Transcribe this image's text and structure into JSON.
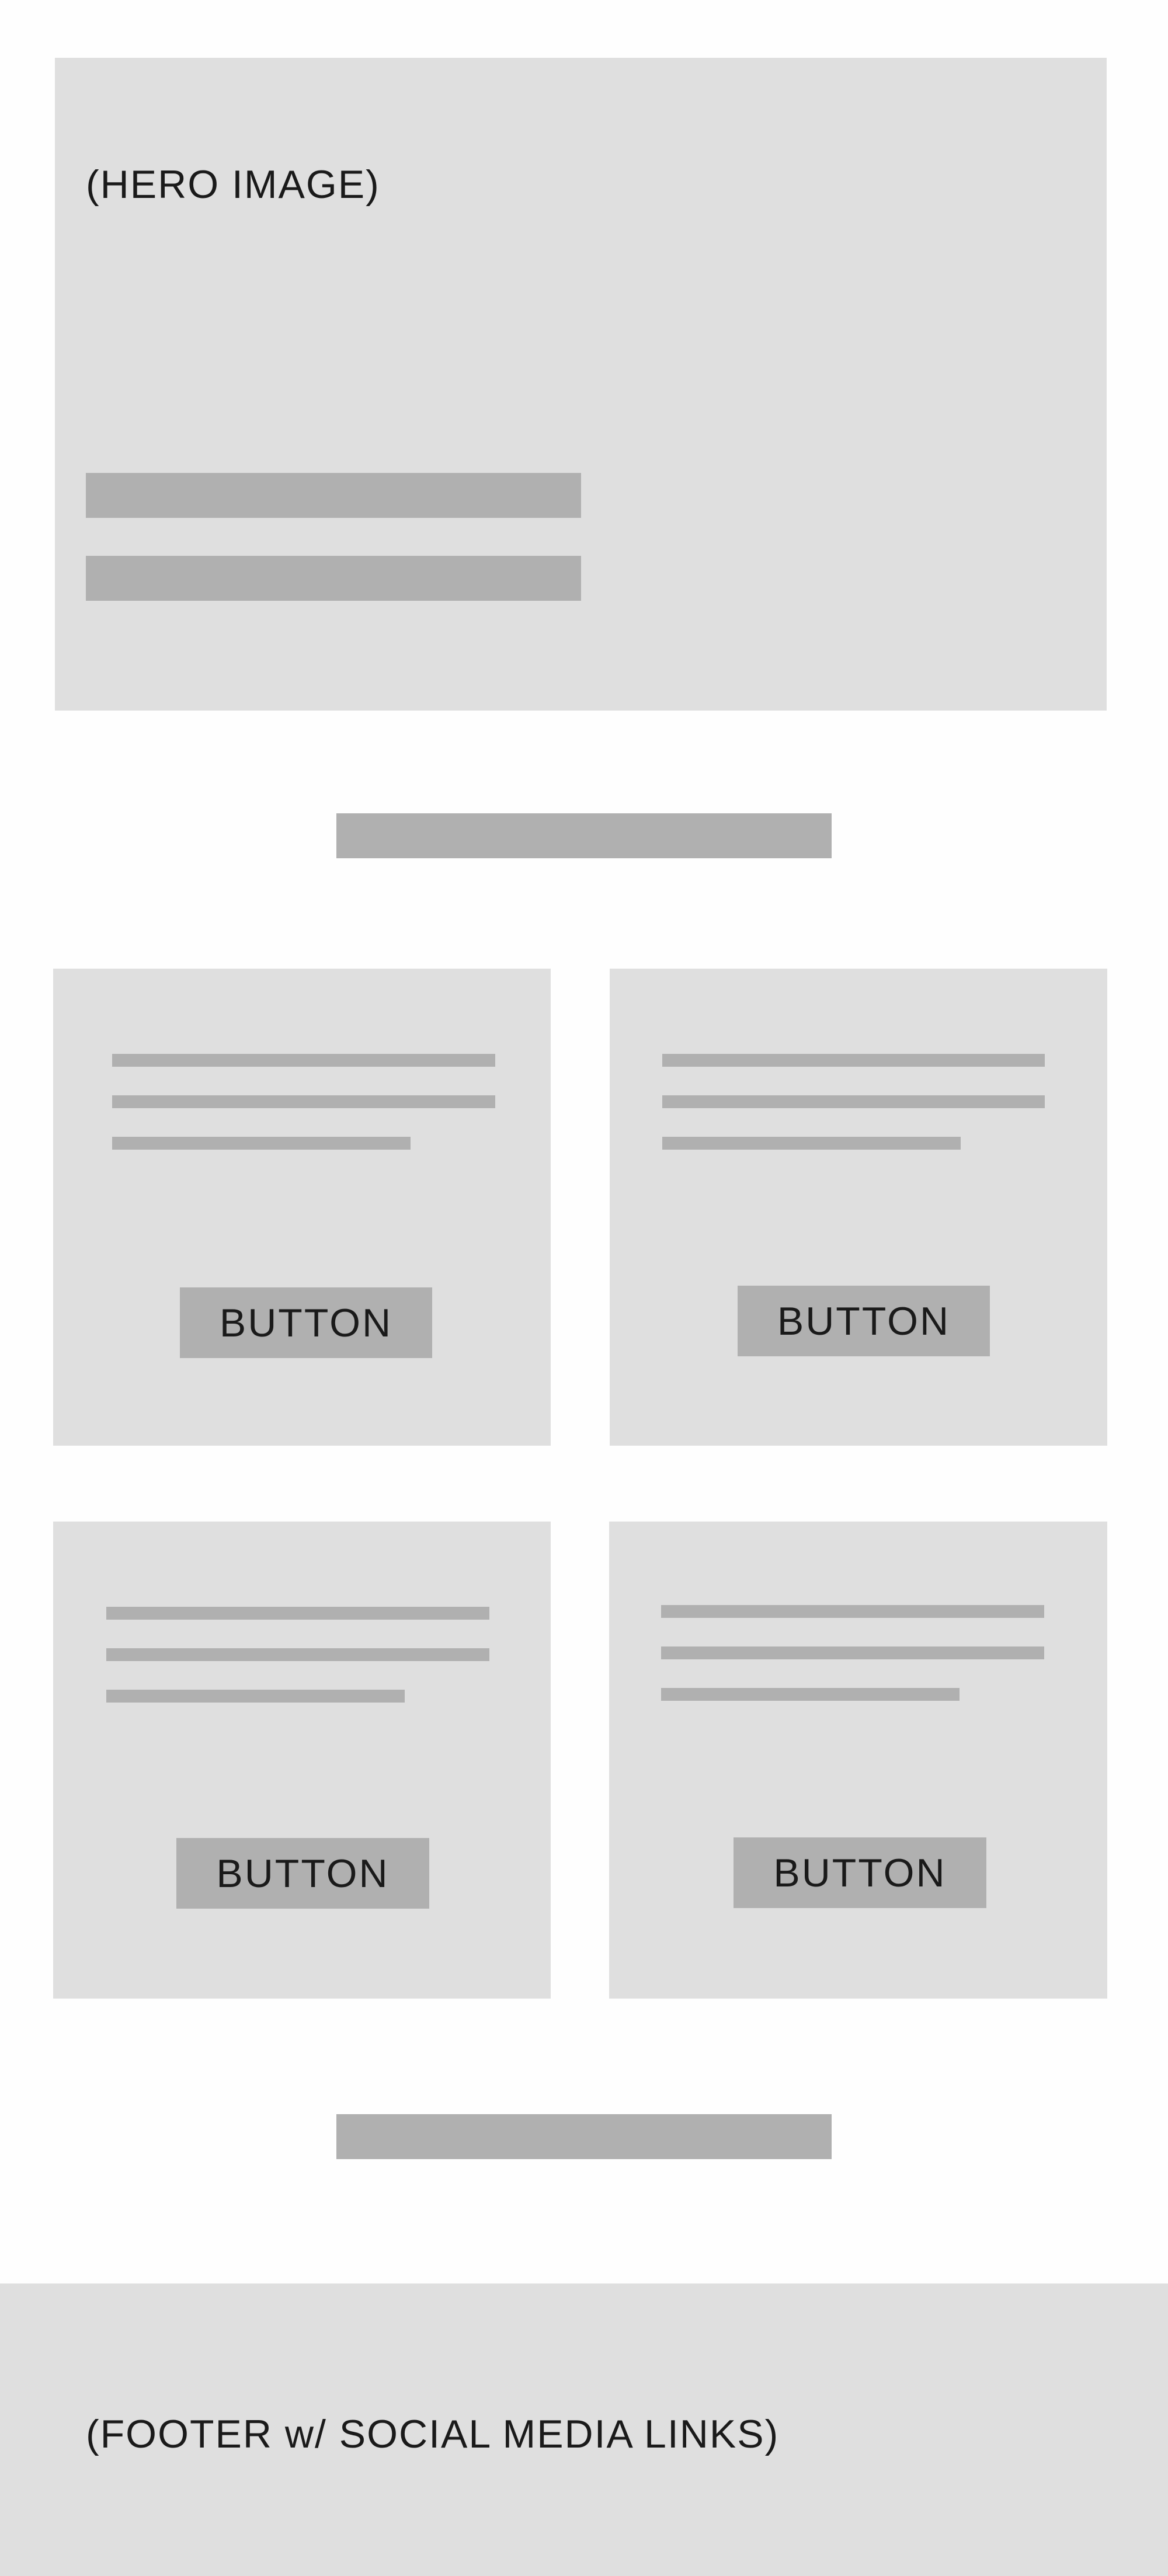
{
  "hero": {
    "label": "(HERO IMAGE)"
  },
  "cards": [
    {
      "button_label": "BUTTON"
    },
    {
      "button_label": "BUTTON"
    },
    {
      "button_label": "BUTTON"
    },
    {
      "button_label": "BUTTON"
    }
  ],
  "footer": {
    "label": "(FOOTER w/ SOCIAL MEDIA LINKS)"
  },
  "colors": {
    "panel": "#dfdfdf",
    "placeholder": "#b0b0b0",
    "background": "#fefefe"
  }
}
